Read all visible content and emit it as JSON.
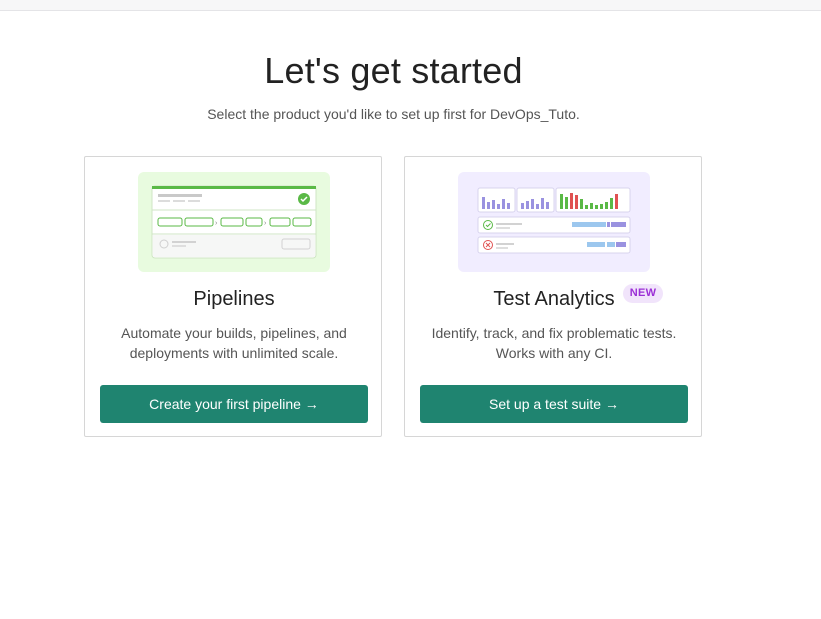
{
  "page": {
    "title": "Let's get started",
    "subtitle": "Select the product you'd like to set up first for DevOps_Tuto."
  },
  "cards": [
    {
      "id": "pipelines",
      "title": "Pipelines",
      "description": "Automate your builds, pipelines, and deployments with unlimited scale.",
      "button_label": "Create your first pipeline →",
      "illustration": "pipelines-illustration",
      "accent_color": "#e8fbdf"
    },
    {
      "id": "test-analytics",
      "title": "Test Analytics",
      "badge": "NEW",
      "description": "Identify, track, and fix problematic tests. Works with any CI.",
      "button_label": "Set up a test suite →",
      "illustration": "test-analytics-illustration",
      "accent_color": "#f1edff"
    }
  ],
  "colors": {
    "button": "#1f8470",
    "badge_bg": "#f1e4fb",
    "badge_text": "#9b2fd6",
    "success": "#5ab946",
    "failure": "#e05252"
  }
}
